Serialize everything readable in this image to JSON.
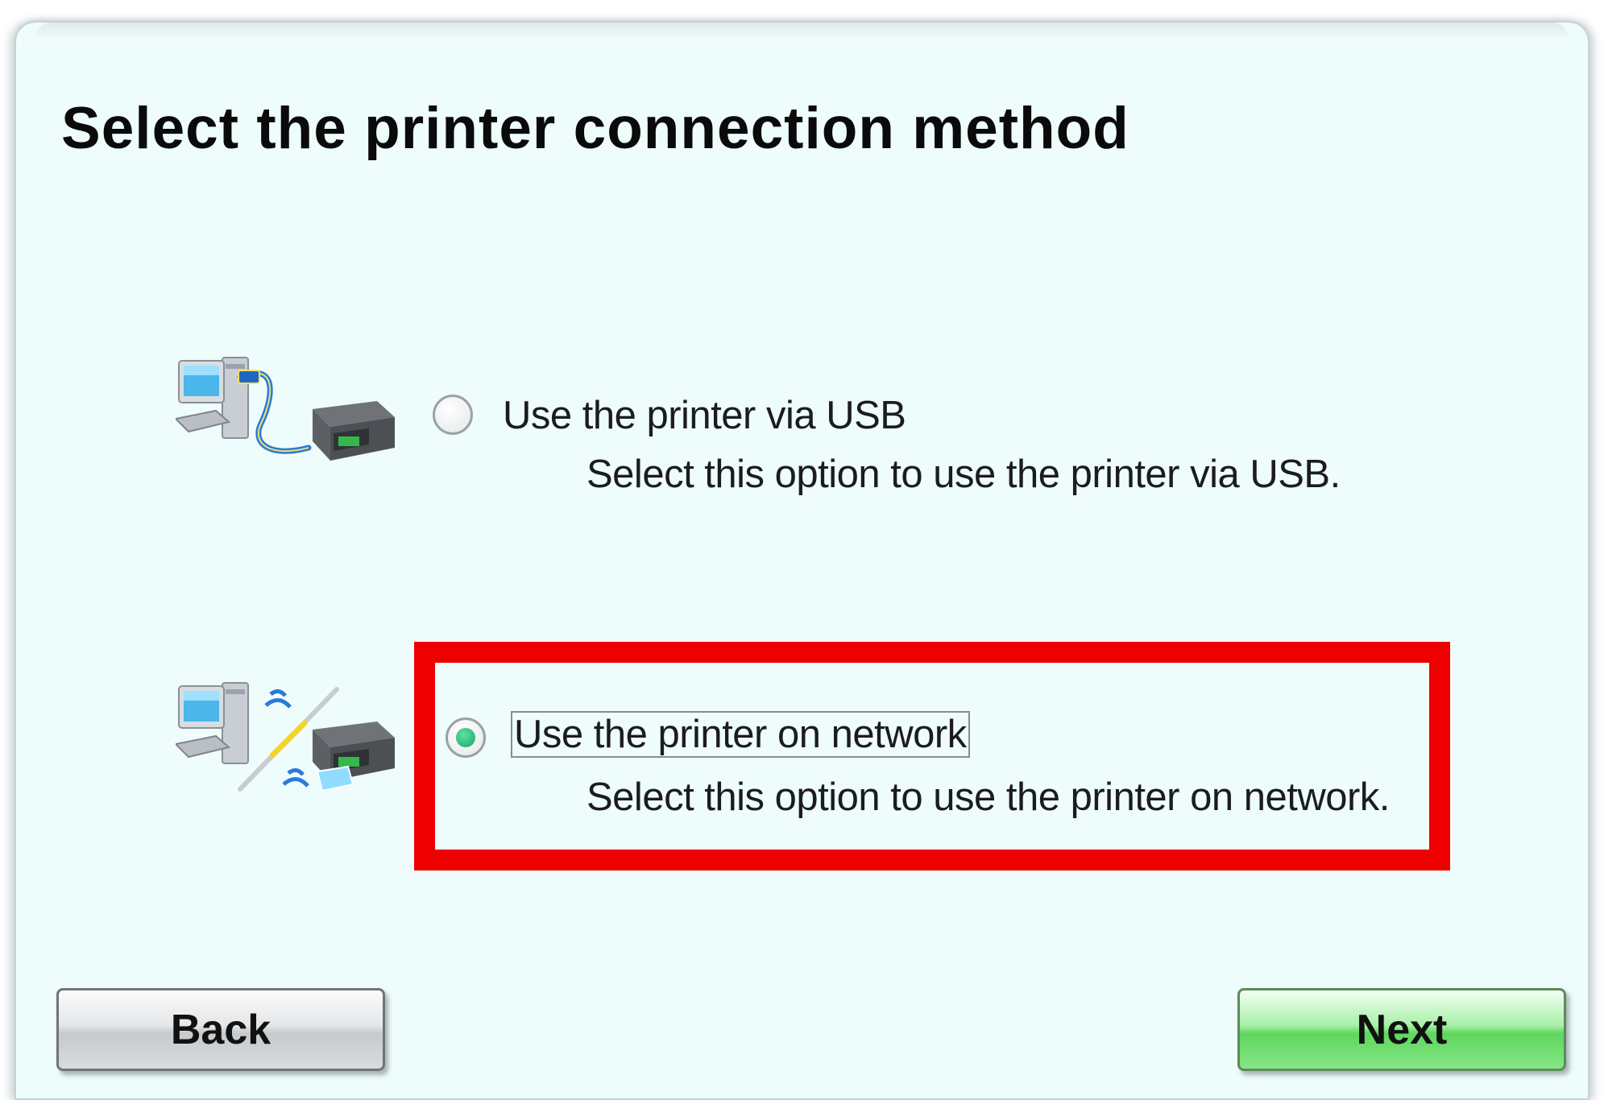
{
  "title": "Select the printer connection method",
  "options": [
    {
      "label": "Use the printer via USB",
      "description": "Select this option to use the printer via USB.",
      "selected": false,
      "icon": "usb-connection-icon"
    },
    {
      "label": "Use the printer on network",
      "description": "Select this option to use the printer on network.",
      "selected": true,
      "icon": "network-connection-icon"
    }
  ],
  "buttons": {
    "back": "Back",
    "next": "Next"
  },
  "colors": {
    "panel_background": "#eefcfc",
    "highlight": "#ee0000",
    "next_button": "#5ed65e",
    "selected_radio": "#13a866"
  }
}
